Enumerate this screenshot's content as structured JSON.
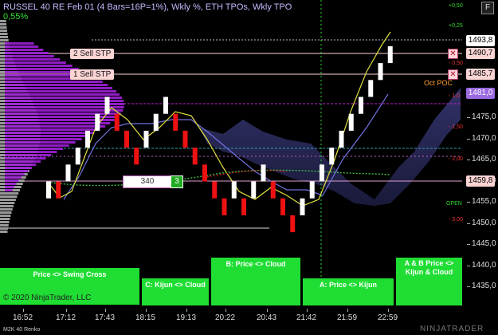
{
  "chart": {
    "title": "RUSSEL 40 RE Feb 01 (4 Bars=16P=1%), Wkly %, ETH TPOs, Wkly TPO",
    "change_pct": "0,55%",
    "copyright": "© 2020 NinjaTrader, LLC",
    "bar_type": "M2K 40 Renko",
    "brand": "NINJATRADER",
    "gear_icon": "gear-icon"
  },
  "orders": [
    {
      "label": "2  Sell STP",
      "price": "1490,7"
    },
    {
      "label": "1  Sell STP",
      "price": "1485,7"
    }
  ],
  "position": {
    "qty": "340",
    "count": "3"
  },
  "price_boxes": {
    "last": "1493,8",
    "poc": "1481,0",
    "level": "1459,8"
  },
  "poc_label": "Oct POC",
  "open_label": "OPEN",
  "y_axis": {
    "ticks": [
      "1475,0",
      "1470,0",
      "1465,0",
      "1460,0",
      "1455,0",
      "1450,0",
      "1445,0",
      "1440,0",
      "1435,0"
    ],
    "pct_marks": [
      "+0,50",
      "+0,25",
      "- 0,50",
      "- 1,0",
      "- 1,50",
      "- 2,00",
      "- 3,00"
    ]
  },
  "x_axis": {
    "ticks": [
      "16:52",
      "17:12",
      "17:43",
      "18:15",
      "19:13",
      "20:22",
      "20:43",
      "21:42",
      "21:59",
      "22:59"
    ]
  },
  "signals": [
    {
      "label": "Price <> Swing Cross"
    },
    {
      "label": "C: Kijun <> Cloud"
    },
    {
      "label": "B: Price <> Cloud"
    },
    {
      "label": "A: Price <> Kijun"
    },
    {
      "label": "A & B Price <> Kijun & Cloud"
    }
  ],
  "colors": {
    "background": "#000000",
    "up": "#ffffff",
    "down": "#ee1111",
    "profile": "#a020d8",
    "signal": "#1fdd33",
    "cloud": "#2a2a5a"
  },
  "chart_data": {
    "type": "candlestick",
    "bar_size": 4,
    "ylim": [
      1431,
      1500
    ],
    "bricks": [
      {
        "dir": "up",
        "open": 1456,
        "close": 1460
      },
      {
        "dir": "down",
        "open": 1460,
        "close": 1456
      },
      {
        "dir": "up",
        "open": 1460,
        "close": 1464
      },
      {
        "dir": "up",
        "open": 1464,
        "close": 1468
      },
      {
        "dir": "up",
        "open": 1468,
        "close": 1472
      },
      {
        "dir": "up",
        "open": 1472,
        "close": 1476
      },
      {
        "dir": "up",
        "open": 1476,
        "close": 1480
      },
      {
        "dir": "down",
        "open": 1476,
        "close": 1472
      },
      {
        "dir": "down",
        "open": 1472,
        "close": 1468
      },
      {
        "dir": "down",
        "open": 1468,
        "close": 1464
      },
      {
        "dir": "up",
        "open": 1468,
        "close": 1472
      },
      {
        "dir": "up",
        "open": 1472,
        "close": 1476
      },
      {
        "dir": "up",
        "open": 1476,
        "close": 1480
      },
      {
        "dir": "down",
        "open": 1476,
        "close": 1472
      },
      {
        "dir": "down",
        "open": 1472,
        "close": 1468
      },
      {
        "dir": "down",
        "open": 1468,
        "close": 1464
      },
      {
        "dir": "down",
        "open": 1464,
        "close": 1460
      },
      {
        "dir": "down",
        "open": 1460,
        "close": 1456
      },
      {
        "dir": "down",
        "open": 1456,
        "close": 1452
      },
      {
        "dir": "up",
        "open": 1456,
        "close": 1460
      },
      {
        "dir": "down",
        "open": 1456,
        "close": 1452
      },
      {
        "dir": "up",
        "open": 1456,
        "close": 1460
      },
      {
        "dir": "up",
        "open": 1460,
        "close": 1464
      },
      {
        "dir": "down",
        "open": 1460,
        "close": 1456
      },
      {
        "dir": "down",
        "open": 1456,
        "close": 1452
      },
      {
        "dir": "down",
        "open": 1452,
        "close": 1448
      },
      {
        "dir": "up",
        "open": 1452,
        "close": 1456
      },
      {
        "dir": "up",
        "open": 1456,
        "close": 1460
      },
      {
        "dir": "up",
        "open": 1460,
        "close": 1464
      },
      {
        "dir": "up",
        "open": 1464,
        "close": 1468
      },
      {
        "dir": "up",
        "open": 1468,
        "close": 1472
      },
      {
        "dir": "up",
        "open": 1472,
        "close": 1476
      },
      {
        "dir": "up",
        "open": 1476,
        "close": 1480
      },
      {
        "dir": "up",
        "open": 1480,
        "close": 1484
      },
      {
        "dir": "up",
        "open": 1484,
        "close": 1488
      },
      {
        "dir": "up",
        "open": 1488,
        "close": 1492
      }
    ]
  }
}
